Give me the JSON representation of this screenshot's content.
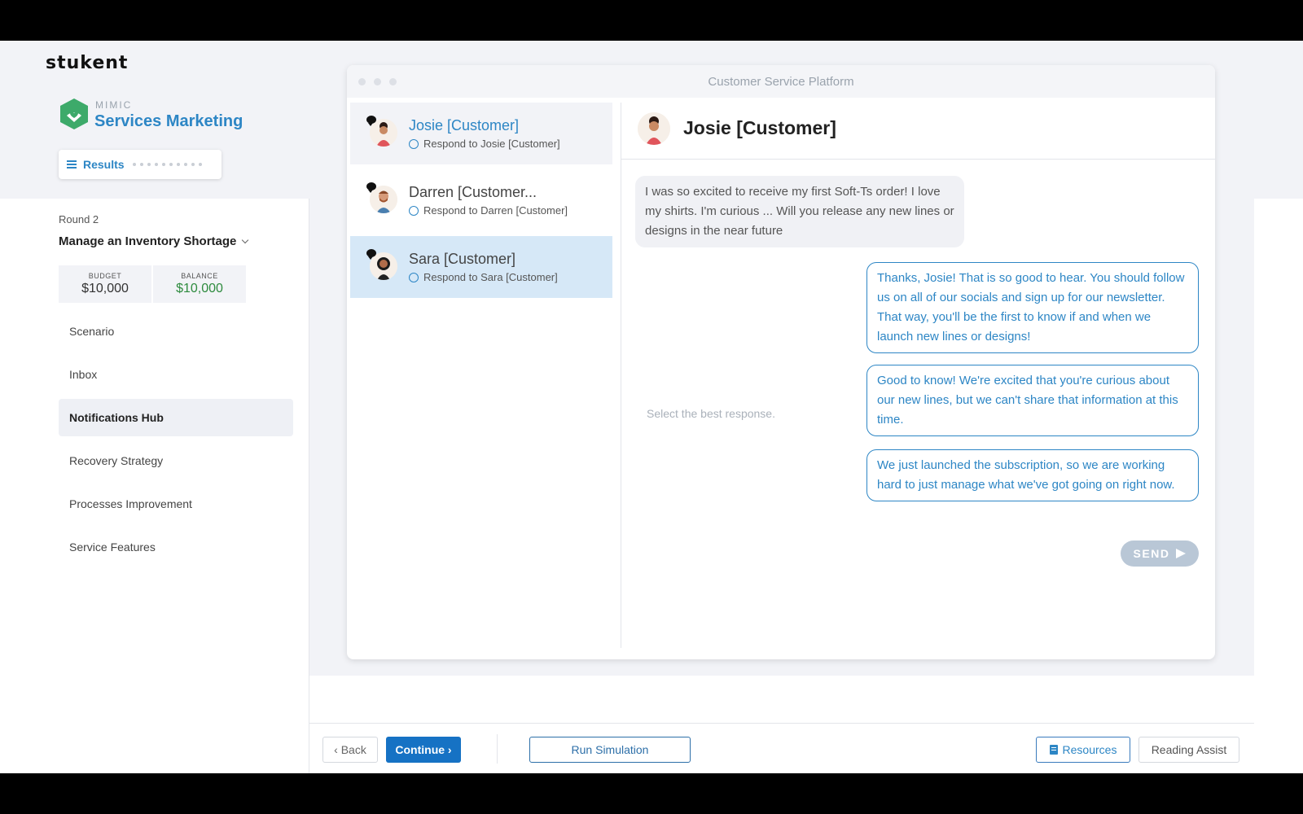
{
  "brand": "stukent",
  "product": {
    "sub": "MIMIC",
    "name": "Services Marketing"
  },
  "results_label": "Results",
  "round_label": "Round 2",
  "scenario_title": "Manage an Inventory Shortage",
  "budget": {
    "budget_label": "BUDGET",
    "budget_value": "$10,000",
    "balance_label": "BALANCE",
    "balance_value": "$10,000"
  },
  "nav": {
    "items": [
      {
        "label": "Scenario"
      },
      {
        "label": "Inbox"
      },
      {
        "label": "Notifications Hub"
      },
      {
        "label": "Recovery Strategy"
      },
      {
        "label": "Processes Improvement"
      },
      {
        "label": "Service Features"
      }
    ]
  },
  "window_title": "Customer Service Platform",
  "conversations": [
    {
      "name": "Josie [Customer]",
      "sub": "Respond to Josie [Customer]"
    },
    {
      "name": "Darren [Customer...",
      "sub": "Respond to Darren [Customer]"
    },
    {
      "name": "Sara [Customer]",
      "sub": "Respond to Sara [Customer]"
    }
  ],
  "chat": {
    "title": "Josie [Customer]",
    "incoming": "I was so excited to receive my first Soft-Ts order! I love my shirts. I'm curious ... Will you release any new lines or designs in the near future",
    "hint": "Select the best response.",
    "options": [
      "Thanks, Josie! That is so good to hear. You should follow us on all of our socials and sign up for our newsletter. That way, you'll be the first to know if and when we launch new lines or designs!",
      "Good to know! We're excited that you're curious about our new lines, but we can't share that information at this time.",
      "We just launched the subscription, so we are working hard to just manage what we've got going on right now."
    ],
    "send_label": "SEND"
  },
  "footer": {
    "back": "‹ Back",
    "continue": "Continue ›",
    "run": "Run Simulation",
    "resources": "Resources",
    "reading": "Reading Assist"
  },
  "colors": {
    "accent": "#2d86c5",
    "primary_button": "#1672c4",
    "balance_green": "#2e8b3e",
    "selected_row": "#d6e8f7"
  }
}
